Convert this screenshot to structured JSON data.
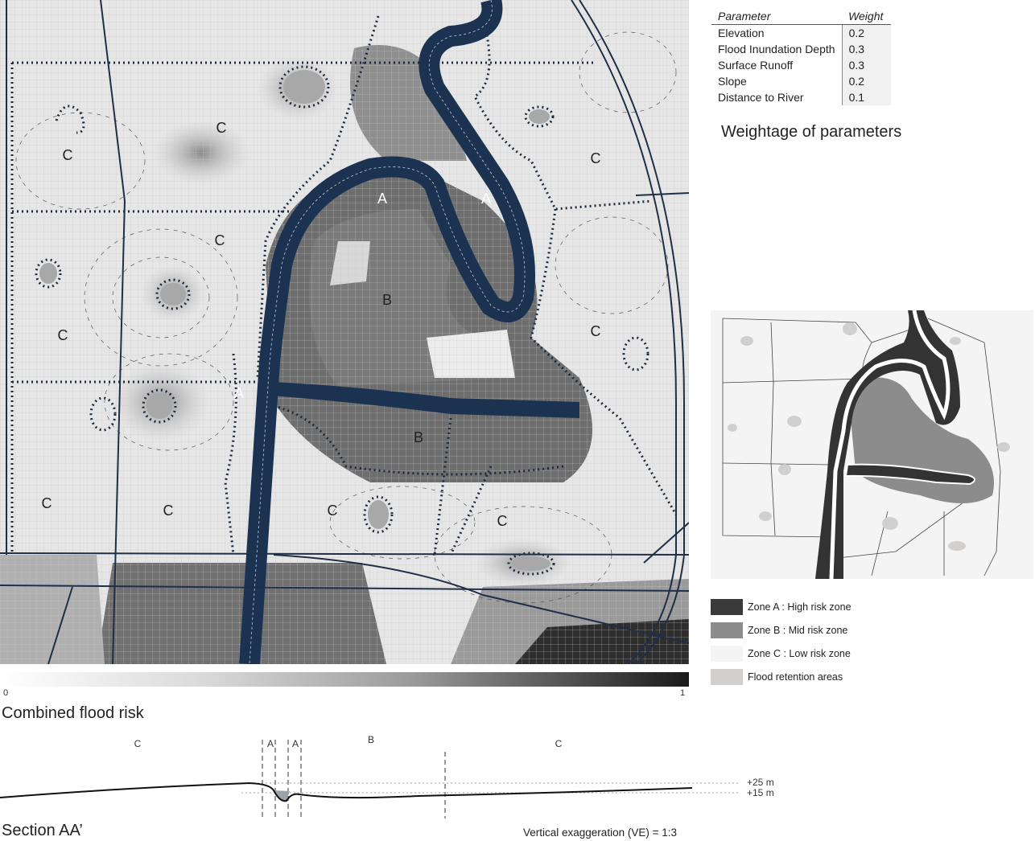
{
  "weights_table": {
    "header_parameter": "Parameter",
    "header_weight": "Weight",
    "rows": [
      {
        "parameter": "Elevation",
        "weight": "0.2"
      },
      {
        "parameter": "Flood Inundation Depth",
        "weight": "0.3"
      },
      {
        "parameter": "Surface Runoff",
        "weight": "0.3"
      },
      {
        "parameter": "Slope",
        "weight": "0.2"
      },
      {
        "parameter": "Distance to River",
        "weight": "0.1"
      }
    ],
    "caption": "Weightage of parameters"
  },
  "main_map": {
    "caption": "Combined flood risk",
    "zone_labels": [
      "C",
      "C",
      "C",
      "C",
      "C",
      "A",
      "A",
      "B",
      "A",
      "B",
      "C",
      "C",
      "C",
      "C",
      "C",
      "C"
    ],
    "scale_min": "0",
    "scale_max": "1"
  },
  "legend": {
    "items": [
      {
        "label": "Zone A : High risk zone",
        "color": "#3a3a3a"
      },
      {
        "label": "Zone B : Mid risk zone",
        "color": "#8c8c8c"
      },
      {
        "label": "Zone C : Low risk zone",
        "color": "#f4f4f4"
      },
      {
        "label": "Flood retention areas",
        "color": "#d2d0ce"
      }
    ]
  },
  "section": {
    "caption": "Section AA’",
    "zone_labels": [
      "C",
      "A",
      "A",
      "B",
      "C"
    ],
    "elevation_high": "+25 m",
    "elevation_low": "+15 m",
    "note": "Vertical exaggeration (VE) = 1:3"
  },
  "colors": {
    "river": "#1b3350",
    "road": "#1e2f48",
    "zone_a": "#3a3a3a",
    "zone_b": "#8c8c8c",
    "retention": "#d2d0ce"
  }
}
